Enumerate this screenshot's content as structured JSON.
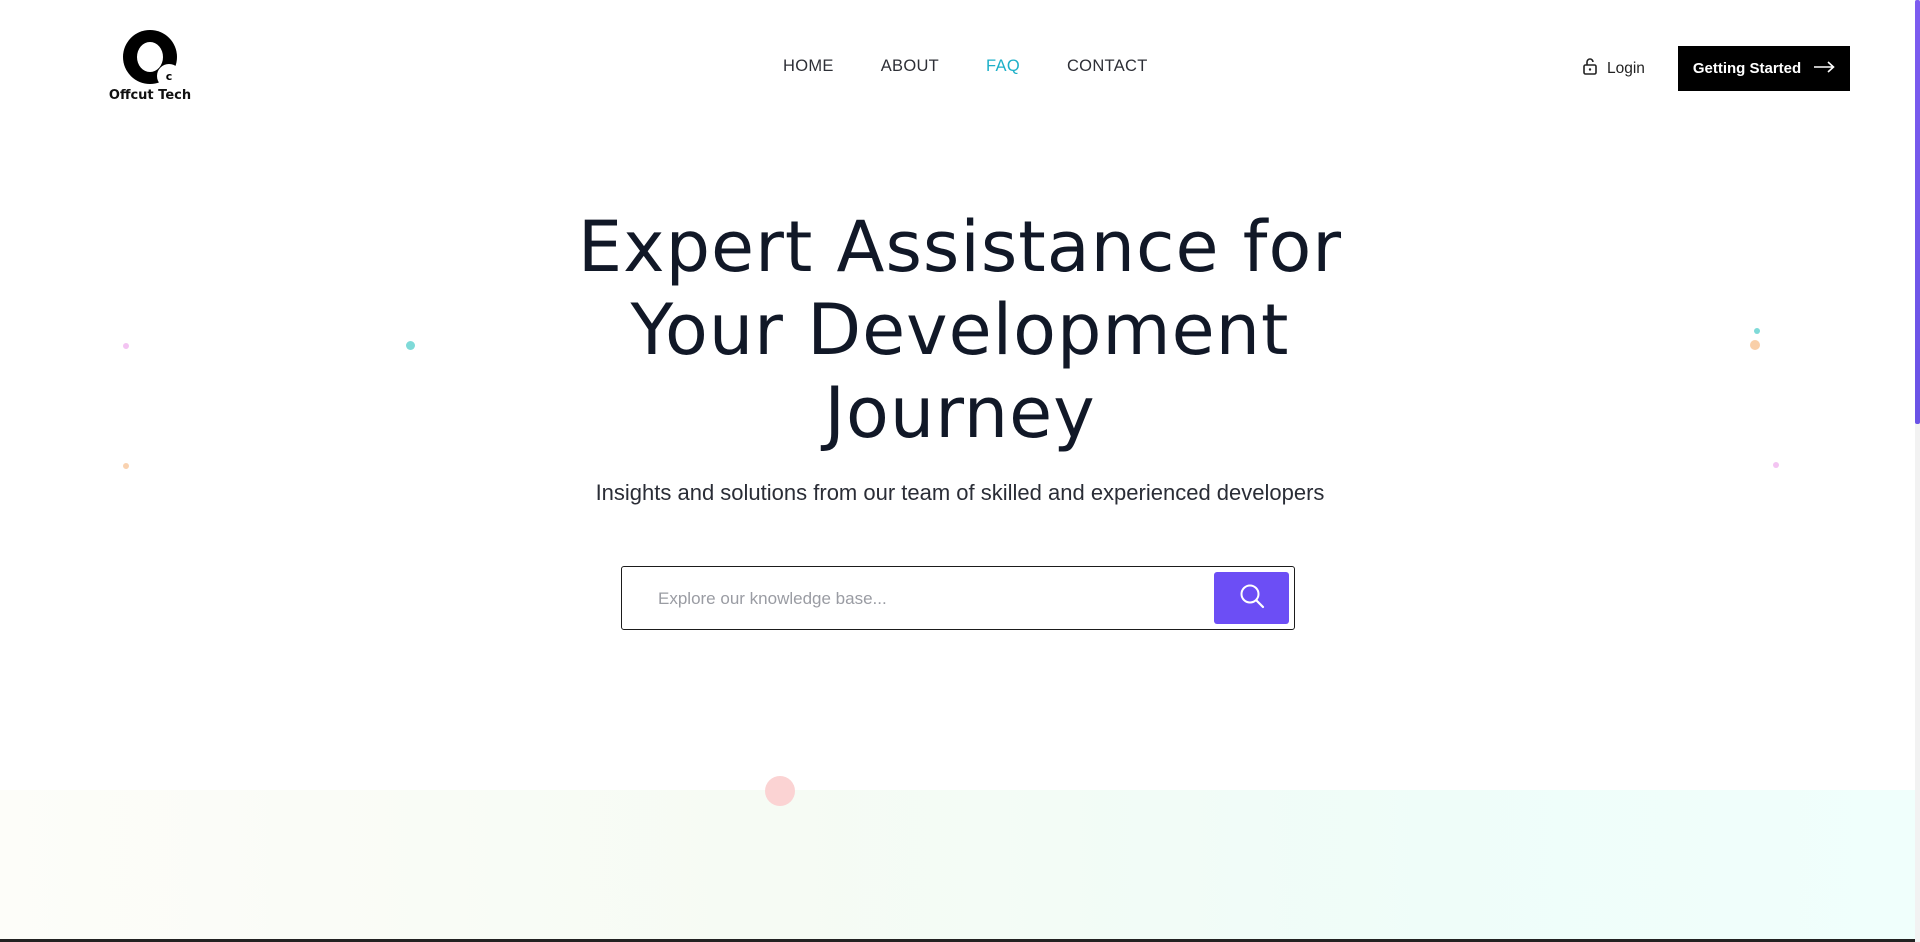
{
  "brand": {
    "name": "Offcut Tech",
    "badge_letter": "c"
  },
  "nav": {
    "items": [
      {
        "label": "HOME",
        "active": false
      },
      {
        "label": "ABOUT",
        "active": false
      },
      {
        "label": "FAQ",
        "active": true
      },
      {
        "label": "CONTACT",
        "active": false
      }
    ]
  },
  "header": {
    "login_label": "Login",
    "cta_label": "Getting Started"
  },
  "hero": {
    "title_lines": [
      "Expert Assistance for",
      "Your Development",
      "Journey"
    ],
    "subtitle": "Insights and solutions from our team of skilled and experienced developers"
  },
  "search": {
    "placeholder": "Explore our knowledge base...",
    "value": ""
  },
  "colors": {
    "accent": "#6c4ef5",
    "nav_active": "#1eb0c8",
    "cta_bg": "#000000"
  },
  "icons": {
    "login": "lock-icon",
    "cta": "arrow-right-icon",
    "search": "search-icon"
  }
}
